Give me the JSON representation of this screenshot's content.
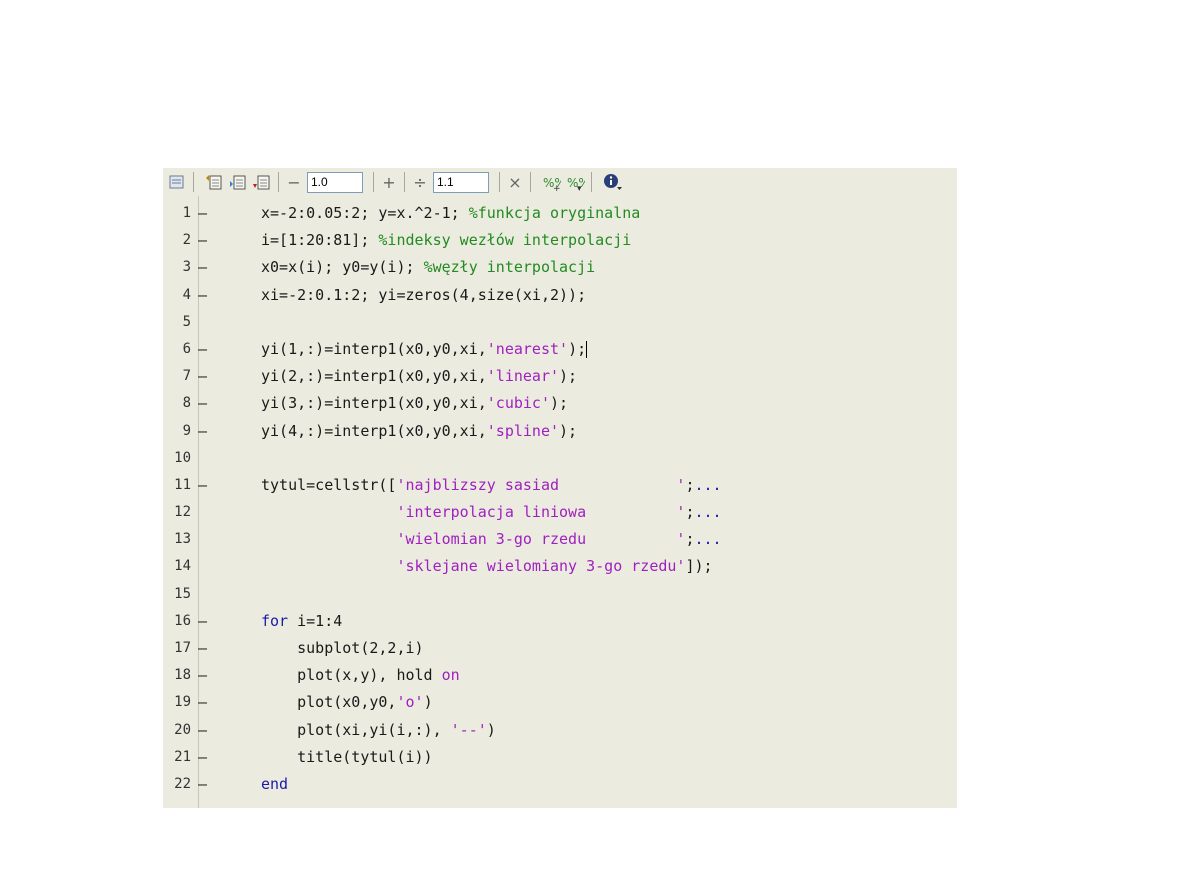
{
  "toolbar": {
    "zoom_a": "1.0",
    "zoom_b": "1.1",
    "minus": "−",
    "plus": "+",
    "divide": "÷",
    "times": "×"
  },
  "lines": [
    {
      "n": "1",
      "marker": "—",
      "segs": [
        [
          "t",
          "x=-2:0.05:2; y=x.^2-1; "
        ],
        [
          "c",
          "%funkcja oryginalna"
        ]
      ]
    },
    {
      "n": "2",
      "marker": "—",
      "segs": [
        [
          "t",
          "i=[1:20:81]; "
        ],
        [
          "c",
          "%indeksy wezłów interpolacji"
        ]
      ]
    },
    {
      "n": "3",
      "marker": "—",
      "segs": [
        [
          "t",
          "x0=x(i); y0=y(i); "
        ],
        [
          "c",
          "%węzły interpolacji"
        ]
      ]
    },
    {
      "n": "4",
      "marker": "—",
      "segs": [
        [
          "t",
          "xi=-2:0.1:2; yi=zeros(4,size(xi,2));"
        ]
      ]
    },
    {
      "n": "5",
      "marker": "",
      "segs": []
    },
    {
      "n": "6",
      "marker": "—",
      "segs": [
        [
          "t",
          "yi(1,:)=interp1(x0,y0,xi,"
        ],
        [
          "s",
          "'nearest'"
        ],
        [
          "t",
          ");"
        ]
      ],
      "caret": true
    },
    {
      "n": "7",
      "marker": "—",
      "segs": [
        [
          "t",
          "yi(2,:)=interp1(x0,y0,xi,"
        ],
        [
          "s",
          "'linear'"
        ],
        [
          "t",
          ");"
        ]
      ]
    },
    {
      "n": "8",
      "marker": "—",
      "segs": [
        [
          "t",
          "yi(3,:)=interp1(x0,y0,xi,"
        ],
        [
          "s",
          "'cubic'"
        ],
        [
          "t",
          ");"
        ]
      ]
    },
    {
      "n": "9",
      "marker": "—",
      "segs": [
        [
          "t",
          "yi(4,:)=interp1(x0,y0,xi,"
        ],
        [
          "s",
          "'spline'"
        ],
        [
          "t",
          ");"
        ]
      ]
    },
    {
      "n": "10",
      "marker": "",
      "segs": []
    },
    {
      "n": "11",
      "marker": "—",
      "segs": [
        [
          "t",
          "tytul=cellstr(["
        ],
        [
          "s",
          "'najblizszy sasiad             '"
        ],
        [
          "t",
          ";"
        ],
        [
          "k",
          "..."
        ]
      ]
    },
    {
      "n": "12",
      "marker": "",
      "segs": [
        [
          "t",
          "               "
        ],
        [
          "s",
          "'interpolacja liniowa          '"
        ],
        [
          "t",
          ";"
        ],
        [
          "k",
          "..."
        ]
      ]
    },
    {
      "n": "13",
      "marker": "",
      "segs": [
        [
          "t",
          "               "
        ],
        [
          "s",
          "'wielomian 3-go rzedu          '"
        ],
        [
          "t",
          ";"
        ],
        [
          "k",
          "..."
        ]
      ]
    },
    {
      "n": "14",
      "marker": "",
      "segs": [
        [
          "t",
          "               "
        ],
        [
          "s",
          "'sklejane wielomiany 3-go rzedu'"
        ],
        [
          "t",
          "]);"
        ]
      ]
    },
    {
      "n": "15",
      "marker": "",
      "segs": []
    },
    {
      "n": "16",
      "marker": "—",
      "segs": [
        [
          "k",
          "for"
        ],
        [
          "t",
          " i=1:4"
        ]
      ]
    },
    {
      "n": "17",
      "marker": "—",
      "segs": [
        [
          "t",
          "    subplot(2,2,i)"
        ]
      ]
    },
    {
      "n": "18",
      "marker": "—",
      "segs": [
        [
          "t",
          "    plot(x,y), hold "
        ],
        [
          "s",
          "on"
        ]
      ]
    },
    {
      "n": "19",
      "marker": "—",
      "segs": [
        [
          "t",
          "    plot(x0,y0,"
        ],
        [
          "s",
          "'o'"
        ],
        [
          "t",
          ")"
        ]
      ]
    },
    {
      "n": "20",
      "marker": "—",
      "segs": [
        [
          "t",
          "    plot(xi,yi(i,:), "
        ],
        [
          "s",
          "'--'"
        ],
        [
          "t",
          ")"
        ]
      ]
    },
    {
      "n": "21",
      "marker": "—",
      "segs": [
        [
          "t",
          "    title(tytul(i))"
        ]
      ]
    },
    {
      "n": "22",
      "marker": "—",
      "segs": [
        [
          "k",
          "end"
        ]
      ]
    }
  ]
}
